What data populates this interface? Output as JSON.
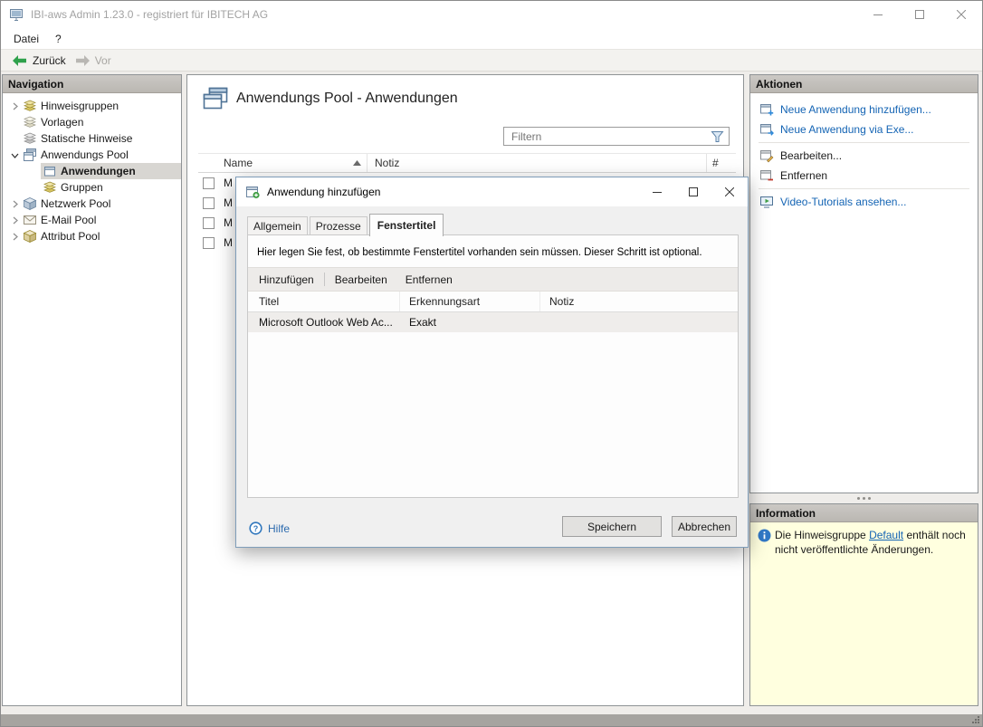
{
  "titlebar": {
    "title": "IBI-aws Admin 1.23.0 - registriert für IBITECH AG"
  },
  "menubar": {
    "items": [
      {
        "label": "Datei"
      },
      {
        "label": "?"
      }
    ]
  },
  "toolbar": {
    "back_label": "Zurück",
    "forward_label": "Vor"
  },
  "navigation": {
    "header": "Navigation",
    "items": [
      {
        "label": "Hinweisgruppen"
      },
      {
        "label": "Vorlagen"
      },
      {
        "label": "Statische Hinweise"
      },
      {
        "label": "Anwendungs Pool"
      },
      {
        "label": "Anwendungen"
      },
      {
        "label": "Gruppen"
      },
      {
        "label": "Netzwerk Pool"
      },
      {
        "label": "E-Mail Pool"
      },
      {
        "label": "Attribut Pool"
      }
    ]
  },
  "main": {
    "title": "Anwendungs Pool - Anwendungen",
    "filter": {
      "placeholder": "Filtern"
    },
    "table": {
      "columns": {
        "name": "Name",
        "notiz": "Notiz",
        "count": "#"
      },
      "rows": [
        {
          "name": "M"
        },
        {
          "name": "M"
        },
        {
          "name": "M"
        },
        {
          "name": "M"
        }
      ]
    }
  },
  "dialog": {
    "title": "Anwendung hinzufügen",
    "tabs": [
      {
        "label": "Allgemein"
      },
      {
        "label": "Prozesse"
      },
      {
        "label": "Fenstertitel"
      }
    ],
    "description": "Hier legen Sie fest, ob bestimmte Fenstertitel vorhanden sein müssen. Dieser Schritt ist optional.",
    "toolbar": {
      "add": "Hinzufügen",
      "edit": "Bearbeiten",
      "remove": "Entfernen"
    },
    "table": {
      "columns": {
        "titel": "Titel",
        "erkennungsart": "Erkennungsart",
        "notiz": "Notiz"
      },
      "rows": [
        {
          "titel": "Microsoft Outlook Web Ac...",
          "erkennungsart": "Exakt",
          "notiz": ""
        }
      ]
    },
    "help_label": "Hilfe",
    "save_label": "Speichern",
    "cancel_label": "Abbrechen"
  },
  "actions": {
    "header": "Aktionen",
    "items": [
      {
        "label": "Neue Anwendung hinzufügen..."
      },
      {
        "label": "Neue Anwendung via Exe..."
      },
      {
        "label": "Bearbeiten..."
      },
      {
        "label": "Entfernen"
      },
      {
        "label": "Video-Tutorials ansehen..."
      }
    ]
  },
  "information": {
    "header": "Information",
    "text_before": "Die Hinweisgruppe",
    "link_label": "Default",
    "text_after": "enthält noch nicht veröffentlichte Änderungen."
  }
}
